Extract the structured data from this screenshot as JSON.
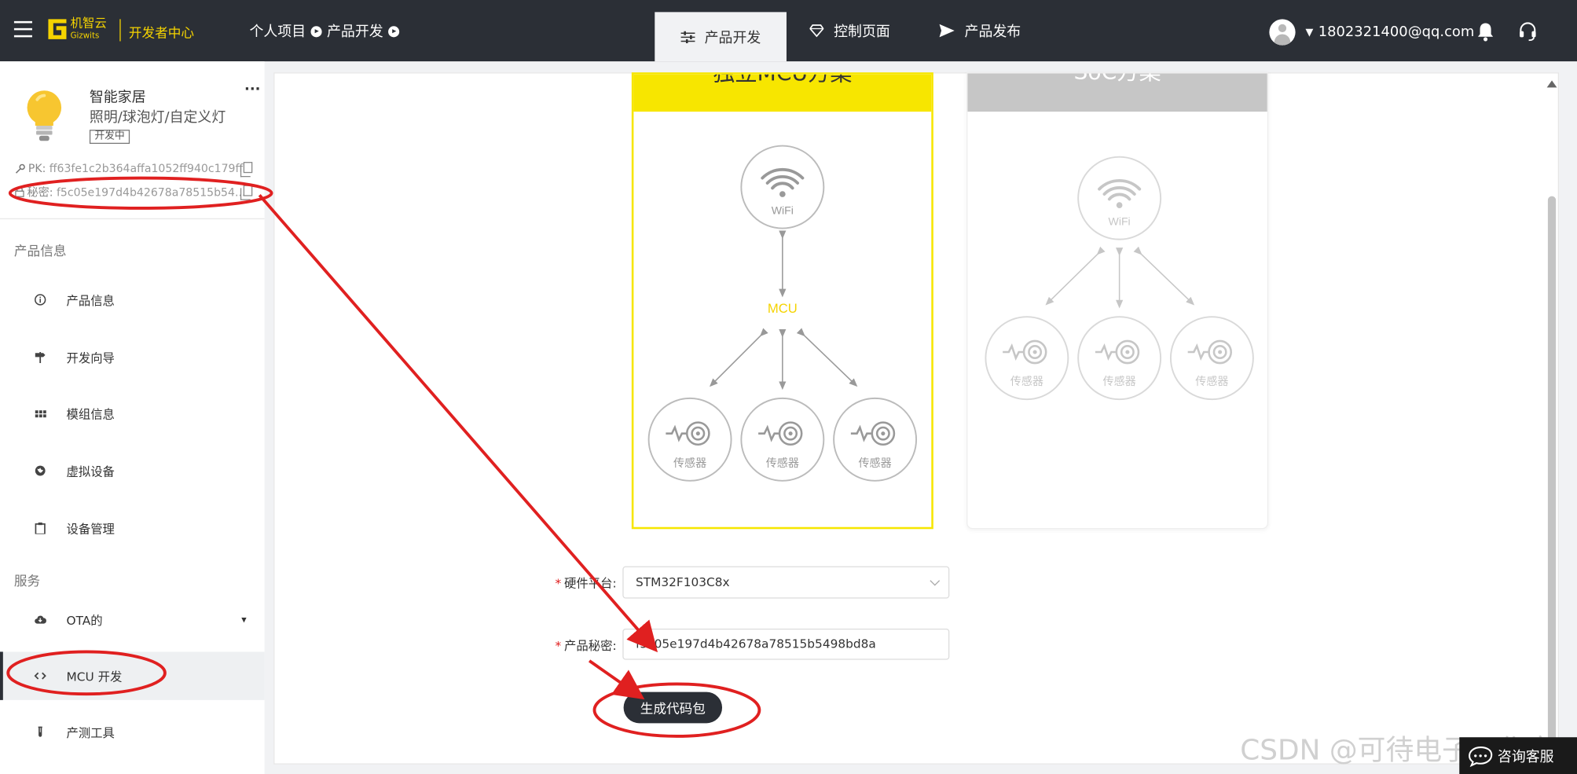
{
  "header": {
    "logo_cn": "机智云",
    "logo_en": "Gizwits",
    "portal_title": "开发者中心",
    "breadcrumbs": [
      "个人项目",
      "产品开发"
    ],
    "tabs": [
      {
        "label": "产品开发",
        "icon": "sliders-icon",
        "active": true
      },
      {
        "label": "控制页面",
        "icon": "diamond-icon",
        "active": false
      },
      {
        "label": "产品发布",
        "icon": "send-icon",
        "active": false
      }
    ],
    "user_email": "1802321400@qq.com",
    "accent_color": "#f5d300",
    "bar_color": "#2b2f36"
  },
  "product": {
    "name": "智能家居",
    "category": "照明/球泡灯/自定义灯",
    "status": "开发中",
    "pk_label": "PK:",
    "pk_value": "ff63fe1c2b364affa1052ff940c179ff",
    "secret_label": "秘密:",
    "secret_value": "f5c05e197d4b42678a78515b54..."
  },
  "sidebar": {
    "section_info": "产品信息",
    "section_service": "服务",
    "items": [
      {
        "label": "产品信息",
        "icon": "info-icon"
      },
      {
        "label": "开发向导",
        "icon": "signpost-icon"
      },
      {
        "label": "模组信息",
        "icon": "grid-icon"
      },
      {
        "label": "虚拟设备",
        "icon": "globe-icon"
      },
      {
        "label": "设备管理",
        "icon": "clipboard-icon"
      },
      {
        "label": "OTA的",
        "icon": "cloud-icon"
      },
      {
        "label": "MCU 开发",
        "icon": "code-icon",
        "active": true
      },
      {
        "label": "产测工具",
        "icon": "test-tube-icon"
      }
    ]
  },
  "main": {
    "card1_title": "独立MCU方案",
    "card2_title": "SoC方案",
    "wifi_label": "WiFi",
    "mcu_label": "MCU",
    "sensor_label": "传感器",
    "hardware_label": "硬件平台:",
    "hardware_value": "STM32F103C8x",
    "secret_label": "产品秘密:",
    "secret_value": "f5c05e197d4b42678a78515b5498bd8a",
    "generate_button": "生成代码包"
  },
  "overlay": {
    "watermark": "CSDN @可待电子工作室",
    "service_label": "咨询客服",
    "annotation_color": "#e02020"
  }
}
